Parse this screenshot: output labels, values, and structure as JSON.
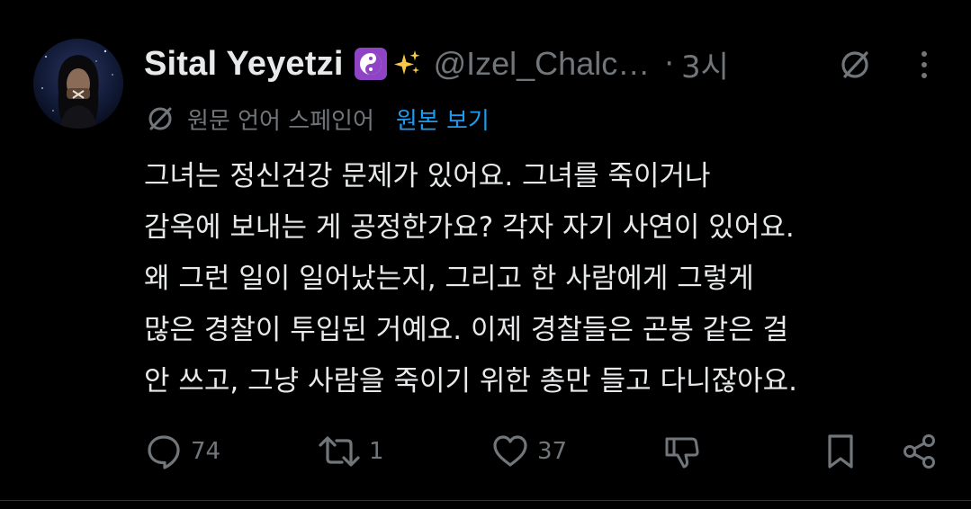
{
  "post": {
    "author": {
      "display_name": "Sital Yeyetzi",
      "name_emojis": [
        "yin-yang-emoji",
        "sparkles-emoji"
      ],
      "handle": "@Izel_Chalc…",
      "avatar_icon": "avatar-photo"
    },
    "separator": "·",
    "time": "3시",
    "translation": {
      "source_language": "원문 언어 스페인어",
      "view_original_label": "원본 보기"
    },
    "text_lines": [
      "그녀는 정신건강 문제가 있어요. 그녀를 죽이거나",
      "감옥에 보내는 게 공정한가요? 각자 자기 사연이 있어요.",
      "왜 그런 일이 일어났는지, 그리고 한 사람에게 그렇게",
      "많은 경찰이 투입된 거예요. 이제 경찰들은 곤봉 같은 걸",
      "안 쓰고, 그냥 사람을 죽이기 위한 총만 들고 다니잖아요."
    ],
    "actions": {
      "reply_count": "74",
      "repost_count": "1",
      "like_count": "37"
    }
  },
  "colors": {
    "background": "#000000",
    "text_primary": "#e7e9ea",
    "text_secondary": "#71767b",
    "link": "#1d9bf0",
    "border": "#2f3336",
    "yinyang_bg": "#8e44c4"
  },
  "icons": [
    "grok-icon",
    "more-icon",
    "translate-icon",
    "reply-icon",
    "repost-icon",
    "like-icon",
    "downvote-icon",
    "bookmark-icon",
    "share-icon"
  ]
}
